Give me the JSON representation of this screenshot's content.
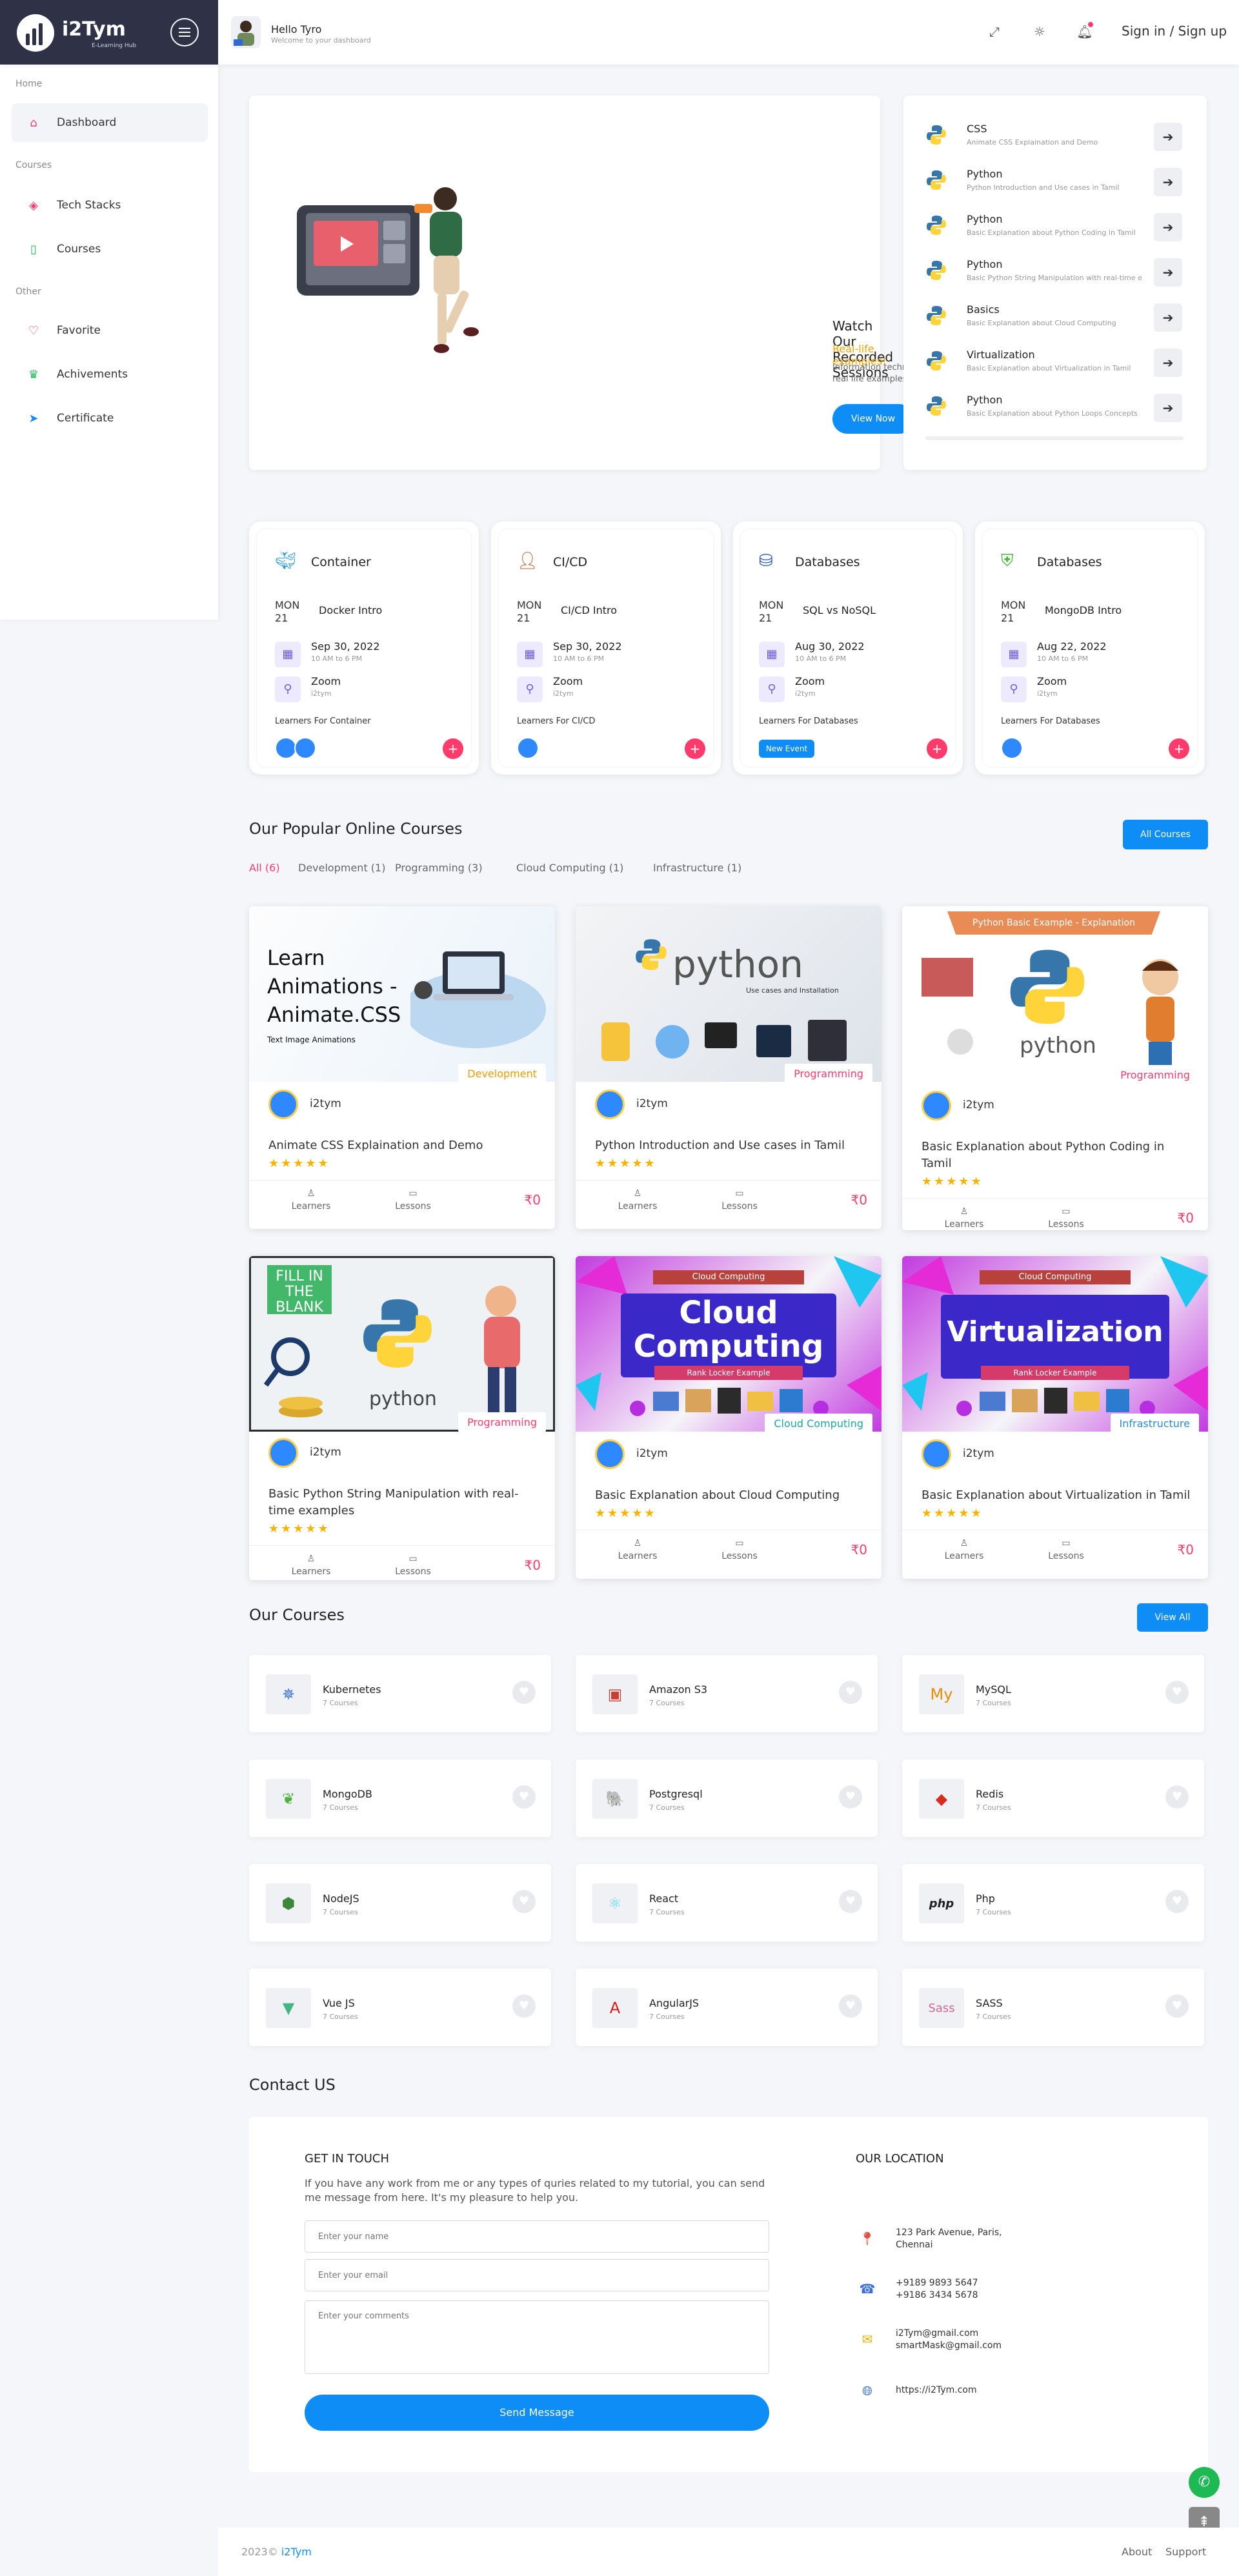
{
  "header": {
    "logo_text": "i2Tym",
    "logo_sub": "E-Learning Hub",
    "greeting_title": "Hello Tyro",
    "greeting_sub": "Welcome to your dashboard",
    "signin_label": "Sign in / Sign up"
  },
  "sidebar": {
    "sections": [
      "Home",
      "Courses",
      "Other"
    ],
    "items": [
      {
        "label": "Dashboard",
        "icon": "home-icon",
        "color": "#ff3b6b"
      },
      {
        "label": "Tech Stacks",
        "icon": "layers-icon",
        "color": "#ff3b6b"
      },
      {
        "label": "Courses",
        "icon": "book-icon",
        "color": "#1db954"
      },
      {
        "label": "Favorite",
        "icon": "heart-icon",
        "color": "#ff3b6b"
      },
      {
        "label": "Achivements",
        "icon": "trophy-icon",
        "color": "#1db954"
      },
      {
        "label": "Certificate",
        "icon": "send-icon",
        "color": "#0d8df5"
      }
    ]
  },
  "hero": {
    "title": "Watch Our Recorded Sessions",
    "subtitle": "Real-life examples!",
    "description": "Information technology concepts explained in simple terms with real life examples",
    "button": "View Now"
  },
  "recent": [
    {
      "title": "CSS",
      "sub": "Animate CSS Explaination and Demo"
    },
    {
      "title": "Python",
      "sub": "Python Introduction and Use cases in Tamil"
    },
    {
      "title": "Python",
      "sub": "Basic Explanation about Python Coding in Tamil"
    },
    {
      "title": "Python",
      "sub": "Basic Python String Manipulation with real-time examples"
    },
    {
      "title": "Basics",
      "sub": "Basic Explanation about Cloud Computing"
    },
    {
      "title": "Virtualization",
      "sub": "Basic Explanation about Virtualization in Tamil"
    },
    {
      "title": "Python",
      "sub": "Basic Explanation about Python Loops Concepts"
    }
  ],
  "events": [
    {
      "title": "Container",
      "day": "MON",
      "date": "21",
      "name": "Docker Intro",
      "when": "Sep 30, 2022",
      "time": "10 AM to 6 PM",
      "where": "Zoom",
      "where_sub": "i2tym",
      "learners": "Learners For Container",
      "icon": "docker-icon"
    },
    {
      "title": "CI/CD",
      "day": "MON",
      "date": "21",
      "name": "CI/CD Intro",
      "when": "Sep 30, 2022",
      "time": "10 AM to 6 PM",
      "where": "Zoom",
      "where_sub": "i2tym",
      "learners": "Learners For CI/CD",
      "icon": "jenkins-icon"
    },
    {
      "title": "Databases",
      "day": "MON",
      "date": "21",
      "name": "SQL vs NoSQL",
      "when": "Aug 30, 2022",
      "time": "10 AM to 6 PM",
      "where": "Zoom",
      "where_sub": "i2tym",
      "learners": "Learners For Databases",
      "icon": "database-icon",
      "badge": "New Event"
    },
    {
      "title": "Databases",
      "day": "MON",
      "date": "21",
      "name": "MongoDB Intro",
      "when": "Aug 22, 2022",
      "time": "10 AM to 6 PM",
      "where": "Zoom",
      "where_sub": "i2tym",
      "learners": "Learners For Databases",
      "icon": "shield-icon"
    }
  ],
  "popular": {
    "title": "Our Popular Online Courses",
    "button": "All Courses",
    "filters": [
      "All (6)",
      "Development (1)",
      "Programming (3)",
      "Cloud Computing (1)",
      "Infrastructure (1)"
    ],
    "courses": [
      {
        "tag": "Development",
        "tag_color": "#f29a00",
        "author": "i2tym",
        "title": "Animate CSS Explaination and Demo",
        "stars": "★★★★★",
        "learners": "Learners",
        "lessons": "Lessons",
        "price": "₹0",
        "img_lines": [
          "Learn",
          "Animations -",
          "Animate.CSS"
        ],
        "img_small": "Text Image Animations"
      },
      {
        "tag": "Programming",
        "tag_color": "#ff3b6b",
        "author": "i2tym",
        "title": "Python Introduction and Use cases in Tamil",
        "stars": "★★★★★",
        "learners": "Learners",
        "lessons": "Lessons",
        "price": "₹0",
        "img_lines": [
          "python"
        ],
        "img_small": "Use cases and Installation"
      },
      {
        "tag": "Programming",
        "tag_color": "#ff3b6b",
        "author": "i2tym",
        "title": "Basic Explanation about Python Coding in Tamil",
        "stars": "★★★★★",
        "learners": "Learners",
        "lessons": "Lessons",
        "price": "₹0",
        "img_lines": [
          "python"
        ],
        "img_small": "Python Basic Example - Explanation"
      },
      {
        "tag": "Programming",
        "tag_color": "#ff3b6b",
        "author": "i2tym",
        "title": "Basic Python String Manipulation with real-time examples",
        "stars": "★★★★★",
        "learners": "Learners",
        "lessons": "Lessons",
        "price": "₹0",
        "img_lines": [
          "python"
        ],
        "img_small": "FILL IN THE BLANK"
      },
      {
        "tag": "Cloud Computing",
        "tag_color": "#1aaa9f",
        "author": "i2tym",
        "title": "Basic Explanation about Cloud Computing",
        "stars": "★★★★★",
        "learners": "Learners",
        "lessons": "Lessons",
        "price": "₹0",
        "img_lines": [
          "Cloud",
          "Computing"
        ],
        "img_small": "Rank Locker Example",
        "img_top": "Cloud Computing"
      },
      {
        "tag": "Infrastructure",
        "tag_color": "#2b8cd6",
        "author": "i2tym",
        "title": "Basic Explanation about Virtualization in Tamil",
        "stars": "★★★★★",
        "learners": "Learners",
        "lessons": "Lessons",
        "price": "₹0",
        "img_lines": [
          "Virtualization"
        ],
        "img_small": "Rank Locker Example",
        "img_top": "Cloud Computing"
      }
    ]
  },
  "our_courses": {
    "title": "Our Courses",
    "button": "View All",
    "items": [
      {
        "name": "Kubernetes",
        "count": "7 Courses",
        "icon": "kubernetes-icon",
        "glyph": "✵",
        "color": "#326ce5"
      },
      {
        "name": "Amazon S3",
        "count": "7 Courses",
        "icon": "aws-s3-icon",
        "glyph": "▣",
        "color": "#c7402f"
      },
      {
        "name": "MySQL",
        "count": "7 Courses",
        "icon": "mysql-icon",
        "glyph": "My",
        "color": "#e48e00"
      },
      {
        "name": "MongoDB",
        "count": "7 Courses",
        "icon": "mongodb-icon",
        "glyph": "❦",
        "color": "#4db33d"
      },
      {
        "name": "Postgresql",
        "count": "7 Courses",
        "icon": "postgresql-icon",
        "glyph": "🐘",
        "color": "#336791"
      },
      {
        "name": "Redis",
        "count": "7 Courses",
        "icon": "redis-icon",
        "glyph": "◆",
        "color": "#d82c20"
      },
      {
        "name": "NodeJS",
        "count": "7 Courses",
        "icon": "nodejs-icon",
        "glyph": "⬢",
        "color": "#3c873a"
      },
      {
        "name": "React",
        "count": "7 Courses",
        "icon": "react-icon",
        "glyph": "⚛",
        "color": "#61dafb"
      },
      {
        "name": "Php",
        "count": "7 Courses",
        "icon": "php-icon",
        "glyph": "php",
        "color": "#222222"
      },
      {
        "name": "Vue JS",
        "count": "7 Courses",
        "icon": "vue-icon",
        "glyph": "▼",
        "color": "#41b883"
      },
      {
        "name": "AngularJS",
        "count": "7 Courses",
        "icon": "angular-icon",
        "glyph": "A",
        "color": "#dd1b16"
      },
      {
        "name": "SASS",
        "count": "7 Courses",
        "icon": "sass-icon",
        "glyph": "Sass",
        "color": "#cd6799"
      }
    ]
  },
  "contact": {
    "title": "Contact US",
    "get_in_touch": "GET IN TOUCH",
    "desc": "If you have any work from me or any types of quries related to my tutorial, you can send me message from here. It's my pleasure to help you.",
    "name_ph": "Enter your name",
    "email_ph": "Enter your email",
    "comments_ph": "Enter your comments",
    "send": "Send Message",
    "location_title": "OUR LOCATION",
    "address": "123 Park Avenue, Paris, Chennai",
    "phone": "+9189 9893 5647\n+9186 3434 5678",
    "email": "i2Tym@gmail.com\nsmartMask@gmail.com",
    "web": "https://i2Tym.com"
  },
  "footer": {
    "copy": "2023© ",
    "brand": "i2Tym",
    "about": "About",
    "support": "Support"
  }
}
